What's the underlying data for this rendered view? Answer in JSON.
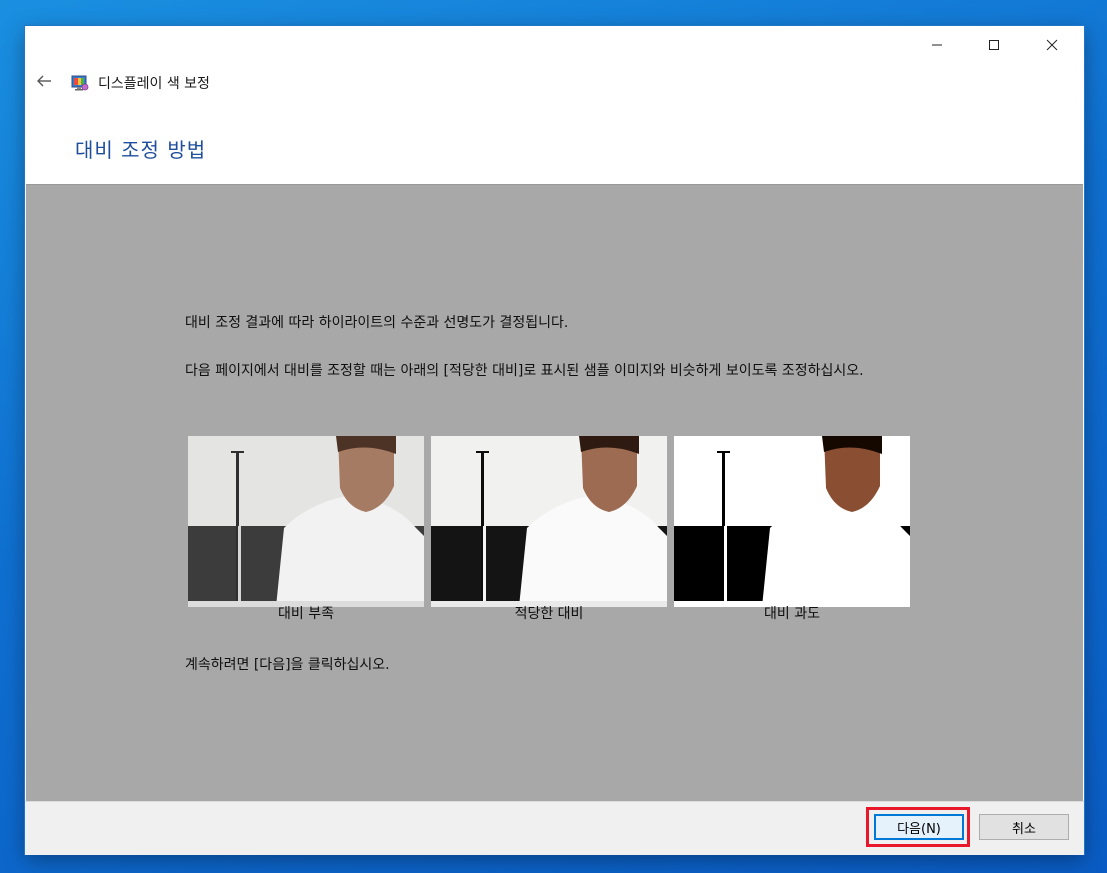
{
  "window": {
    "title": "디스플레이 색 보정",
    "page_heading": "대비 조정 방법"
  },
  "content": {
    "paragraph1": "대비 조정 결과에 따라 하이라이트의 수준과 선명도가 결정됩니다.",
    "paragraph2": "다음 페이지에서 대비를 조정할 때는 아래의 [적당한 대비]로 표시된 샘플 이미지와 비슷하게 보이도록 조정하십시오.",
    "paragraph3": "계속하려면 [다음]을 클릭하십시오.",
    "samples": [
      {
        "caption": "대비 부족"
      },
      {
        "caption": "적당한 대비"
      },
      {
        "caption": "대비 과도"
      }
    ]
  },
  "footer": {
    "next_label": "다음(N)",
    "cancel_label": "취소"
  },
  "colors": {
    "heading": "#1f4e9c",
    "content_bg": "#a8a8a8",
    "highlight": "#e8182a",
    "accent": "#0078d7"
  },
  "icons": [
    "back-arrow-icon",
    "display-color-calibration-icon",
    "minimize-icon",
    "maximize-icon",
    "close-icon"
  ]
}
